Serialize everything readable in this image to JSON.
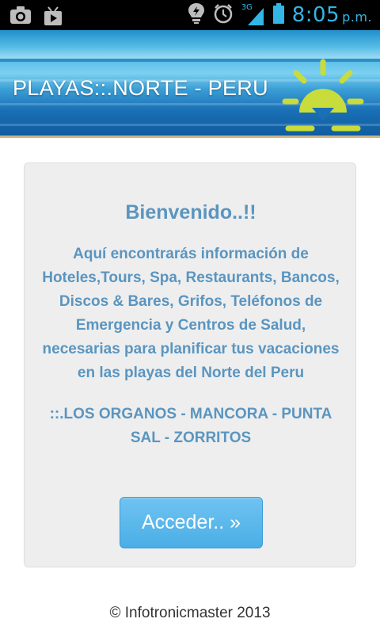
{
  "status_bar": {
    "icons_left": [
      "camera-icon",
      "play-store-icon"
    ],
    "icons_right": [
      "lightbulb-icon",
      "alarm-icon",
      "signal-icon",
      "battery-icon"
    ],
    "network": "3G",
    "time": "8:05",
    "ampm": "p.m.",
    "clock_color": "#33b5e5"
  },
  "header": {
    "title": "PLAYAS::.NORTE - PERU",
    "logo": "sun-icon",
    "logo_color": "#c8dc3c"
  },
  "main": {
    "welcome": "Bienvenido..!!",
    "intro": "Aquí encontrarás información de Hoteles,Tours, Spa, Restaurants, Bancos, Discos & Bares, Grifos, Teléfonos de Emergencia y Centros de Salud, necesarias para planificar tus vacaciones en las playas del Norte del Peru",
    "places": "::.LOS ORGANOS - MANCORA - PUNTA SAL - ZORRITOS",
    "access_button": "Acceder.. »",
    "text_color": "#5a95c0",
    "button_color": "#4aaee6"
  },
  "footer": {
    "copyright": "© Infotronicmaster 2013"
  }
}
